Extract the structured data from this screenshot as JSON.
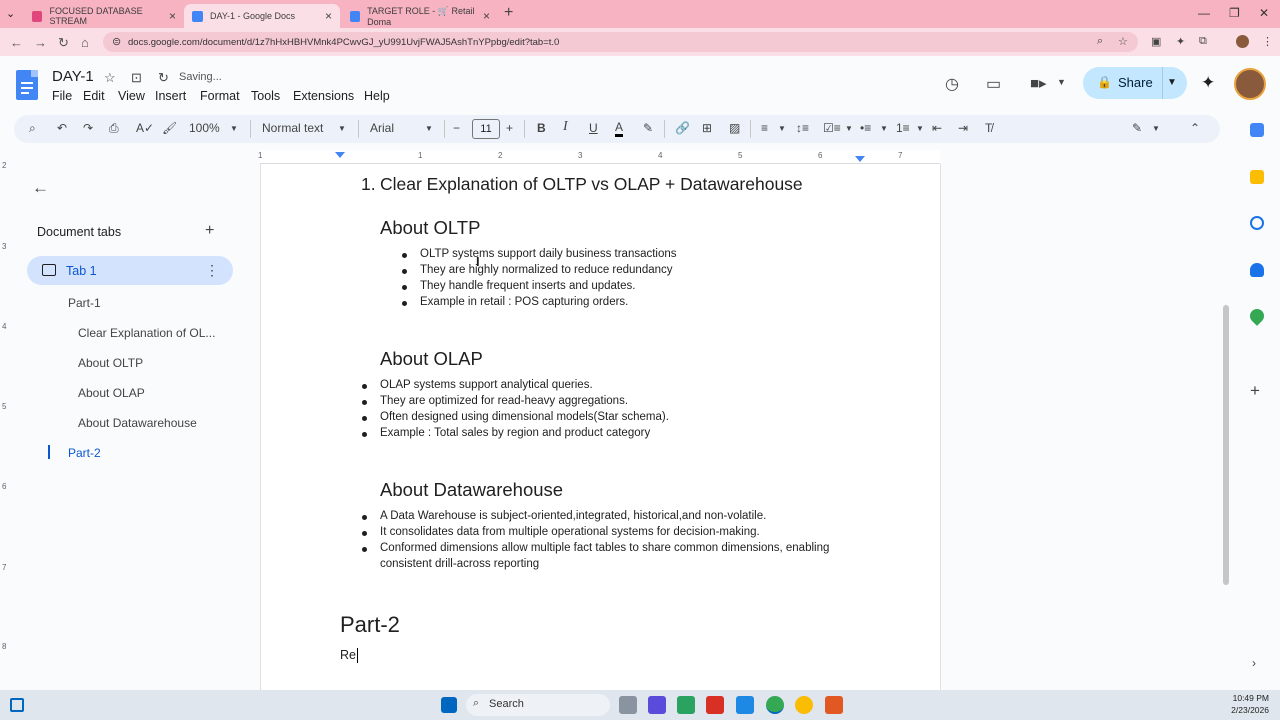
{
  "browser": {
    "tabs": [
      {
        "title": "FOCUSED DATABASE STREAM"
      },
      {
        "title": "DAY-1 - Google Docs"
      },
      {
        "title": "TARGET ROLE - 🛒 Retail Doma"
      }
    ],
    "url": "docs.google.com/document/d/1z7hHxHBHVMnk4PCwvGJ_yU991UvjFWAJ5AshTnYPpbg/edit?tab=t.0"
  },
  "docs": {
    "title": "DAY-1",
    "status": "Saving...",
    "menu": [
      "File",
      "Edit",
      "View",
      "Insert",
      "Format",
      "Tools",
      "Extensions",
      "Help"
    ],
    "share_label": "Share"
  },
  "toolbar": {
    "zoom": "100%",
    "style": "Normal text",
    "font": "Arial",
    "font_size": "11"
  },
  "ruler": {
    "h_numbers": [
      "1",
      "1",
      "2",
      "3",
      "4",
      "5",
      "6",
      "7"
    ],
    "v_numbers": [
      "2",
      "3",
      "4",
      "5",
      "6",
      "7",
      "8"
    ]
  },
  "outline": {
    "heading": "Document tabs",
    "tab_label": "Tab 1",
    "items": [
      "Part-1",
      "Clear Explanation of OL...",
      "About OLTP",
      "About OLAP",
      "About Datawarehouse",
      "Part-2"
    ]
  },
  "document": {
    "heading1_number": "1.",
    "heading1": "Clear Explanation of OLTP vs OLAP + Datawarehouse",
    "sections": [
      {
        "title": "About OLTP",
        "bullets": [
          "OLTP systems support daily business transactions",
          "They are highly normalized to reduce redundancy",
          "They handle frequent inserts and updates.",
          "Example in retail : POS capturing orders."
        ]
      },
      {
        "title": "About OLAP",
        "bullets": [
          "OLAP systems support analytical queries.",
          "They are optimized for read-heavy aggregations.",
          "Often designed using dimensional models(Star schema).",
          "Example : Total sales by region and product category"
        ]
      },
      {
        "title": "About Datawarehouse",
        "bullets": [
          "A Data Warehouse is subject-oriented,integrated, historical,and non-volatile.",
          "It consolidates data from multiple operational systems for decision-making.",
          "Conformed dimensions allow multiple fact tables to share common dimensions, enabling",
          "consistent drill-across reporting"
        ]
      }
    ],
    "part2_title": "Part-2",
    "typing_text": "Re"
  },
  "taskbar": {
    "search_label": "Search",
    "time": "10:49 PM",
    "date": "2/23/2026"
  },
  "colors": {
    "tab_strip": "#f7b3c2",
    "share_button": "#c2e7ff",
    "active_tab_pill": "#d3e3fd",
    "accent": "#0b57d0"
  }
}
